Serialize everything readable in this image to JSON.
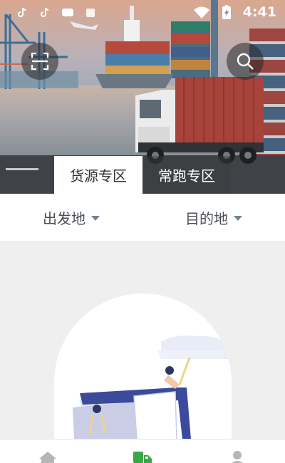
{
  "status_bar": {
    "time": "4:41",
    "icons": [
      "tiktok-icon",
      "tiktok-icon",
      "message-icon",
      "notification-icon",
      "wifi-icon",
      "battery-charging-icon"
    ]
  },
  "hero": {
    "image_description_icon": "port-truck-banner",
    "scan_button_icon": "scan-icon",
    "search_button_icon": "search-icon"
  },
  "zone_tabs": [
    {
      "label": "货源专区",
      "active": true
    },
    {
      "label": "常跑专区",
      "active": false
    }
  ],
  "filters": {
    "origin": "出发地",
    "destination": "目的地"
  },
  "bottom_nav": {
    "items": [
      {
        "icon": "home-icon",
        "active": false
      },
      {
        "icon": "truck-icon",
        "active": true
      },
      {
        "icon": "profile-icon",
        "active": false
      }
    ]
  },
  "colors": {
    "accent": "#3aa846",
    "caret": "#6e8396",
    "illustration_blue": "#3b4a9a",
    "background": "#efefef"
  }
}
